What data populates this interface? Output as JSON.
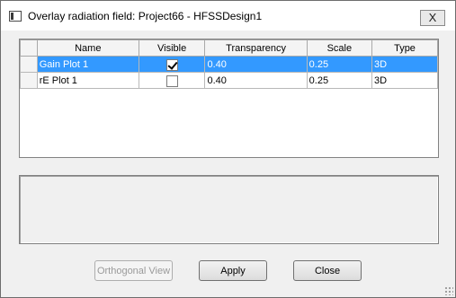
{
  "window": {
    "title": "Overlay radiation field: Project66 - HFSSDesign1",
    "close_glyph": "X"
  },
  "table": {
    "columns": [
      "Name",
      "Visible",
      "Transparency",
      "Scale",
      "Type"
    ],
    "rows": [
      {
        "name": "Gain Plot 1",
        "visible": true,
        "transparency": "0.40",
        "scale": "0.25",
        "type": "3D",
        "selected": true
      },
      {
        "name": "rE Plot 1",
        "visible": false,
        "transparency": "0.40",
        "scale": "0.25",
        "type": "3D",
        "selected": false
      }
    ]
  },
  "buttons": {
    "orthogonal_view": "Orthogonal View",
    "apply": "Apply",
    "close": "Close"
  },
  "colors": {
    "selection": "#3399ff"
  }
}
